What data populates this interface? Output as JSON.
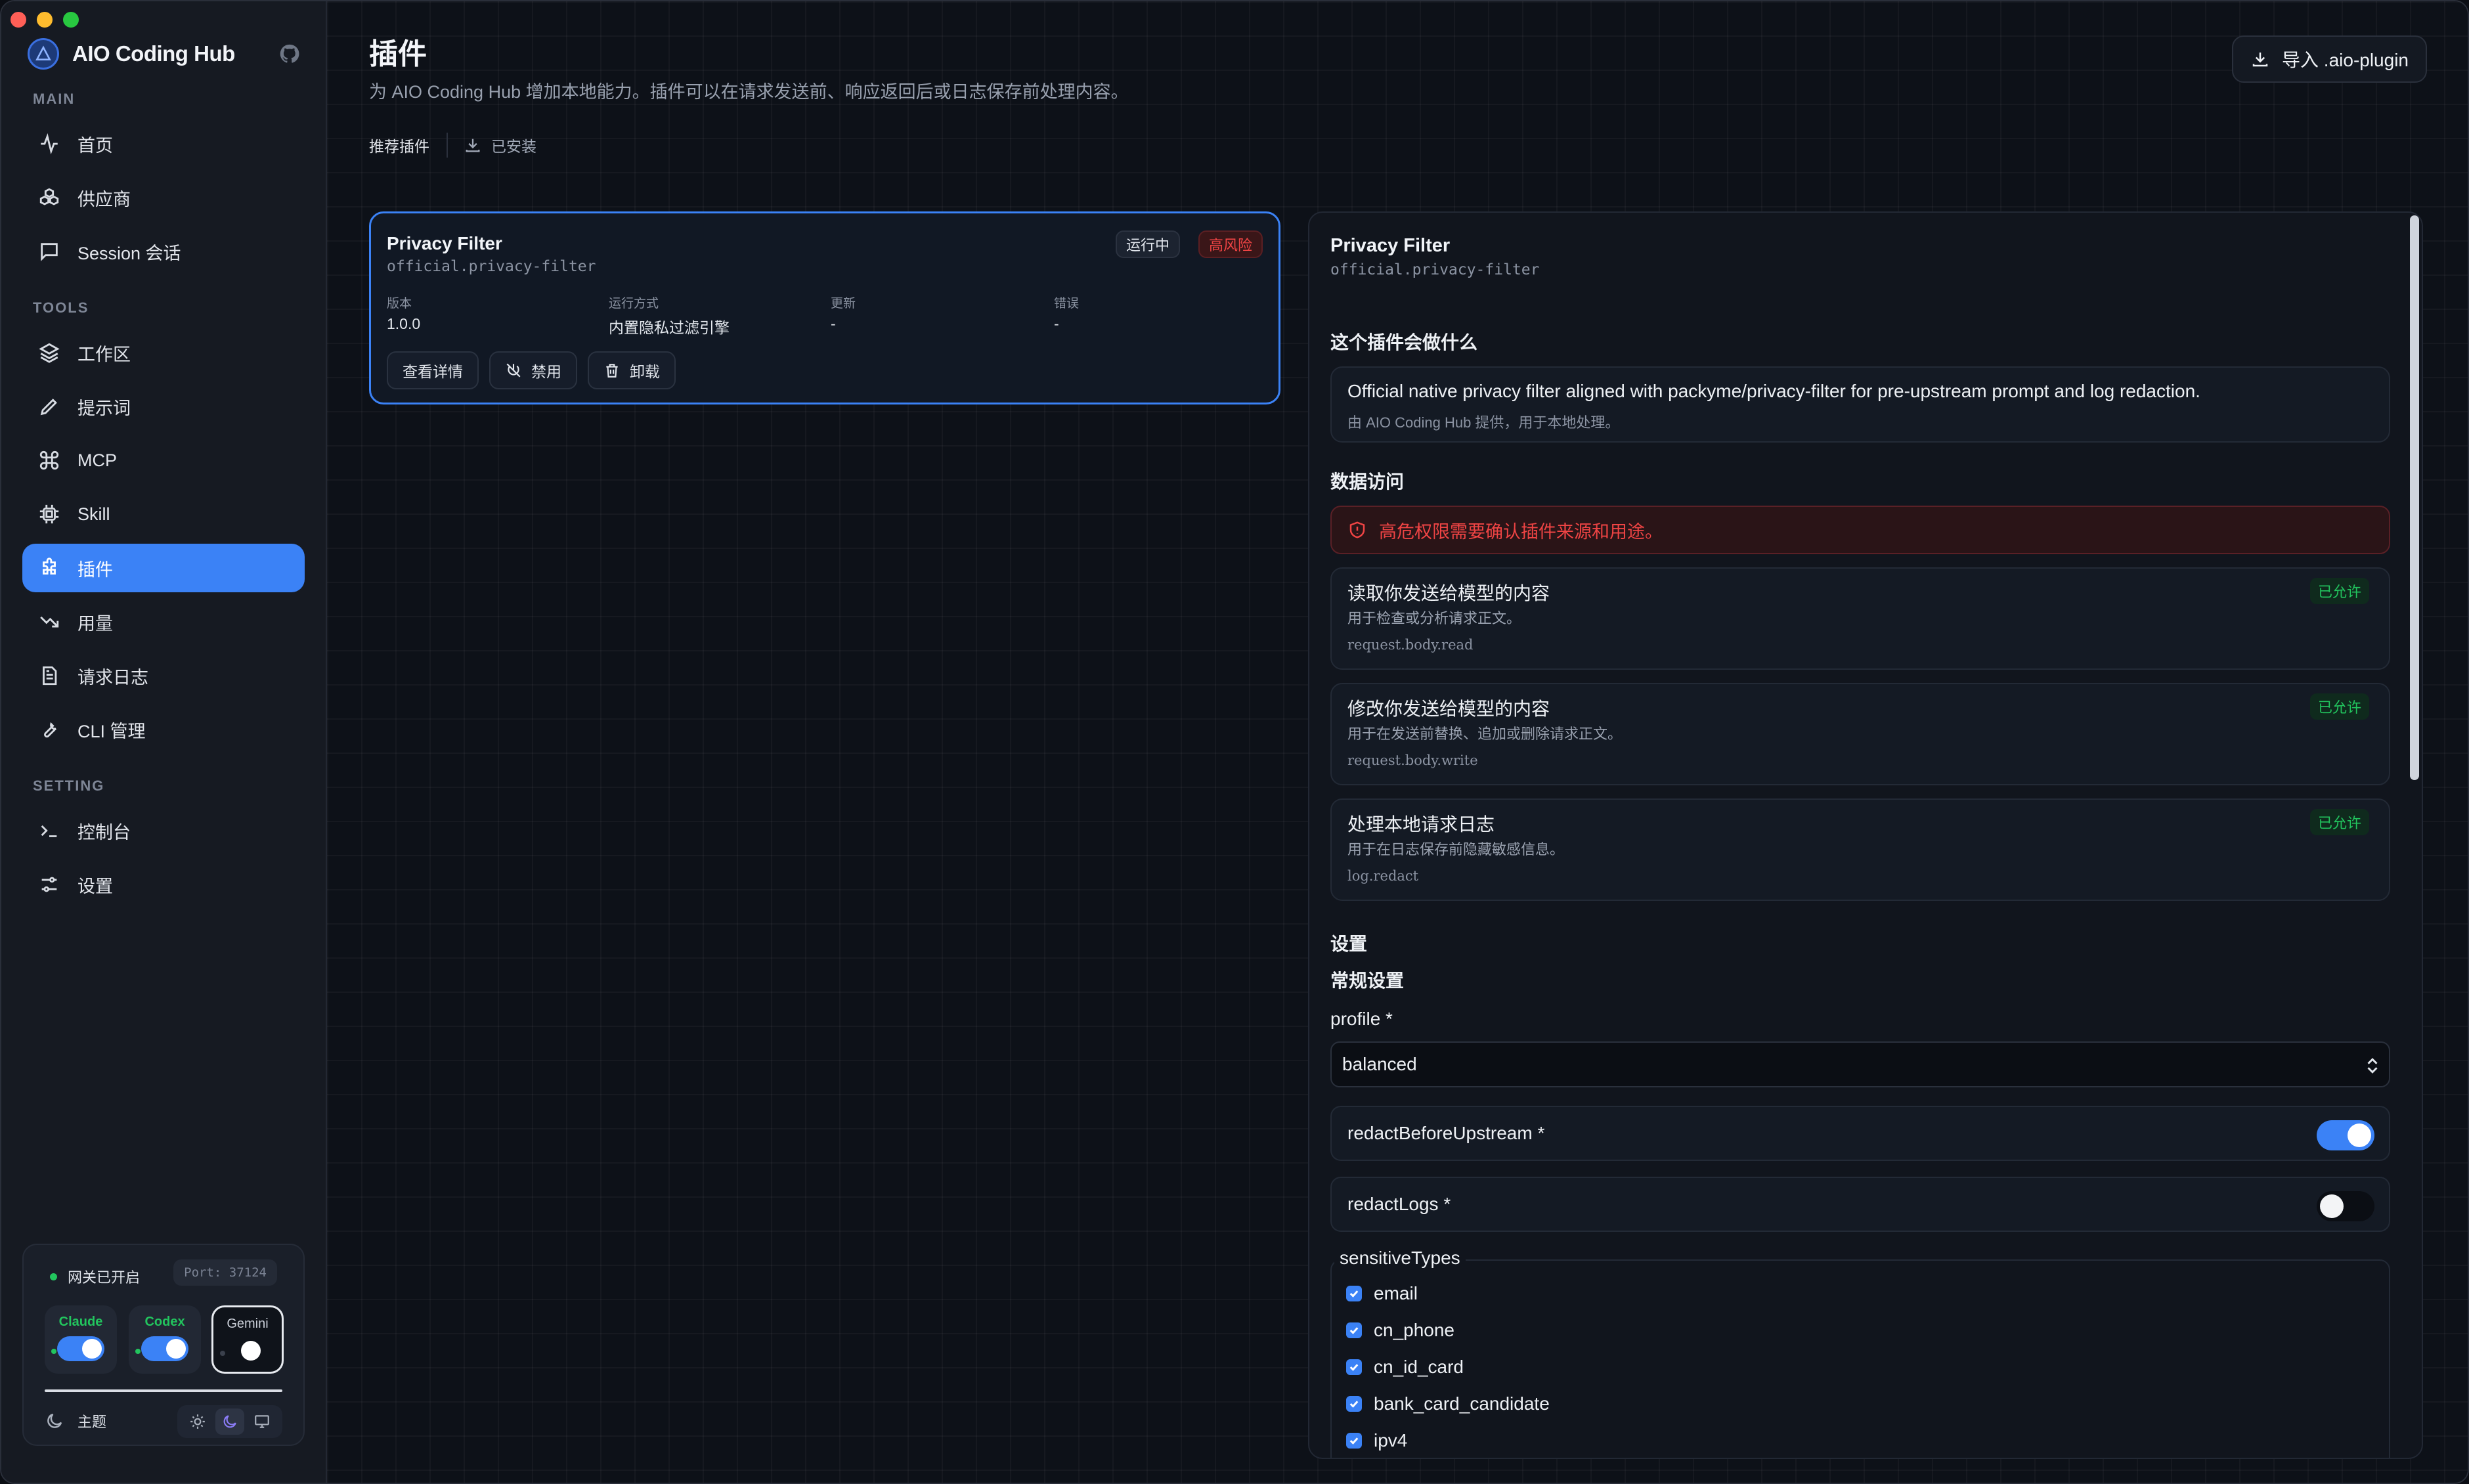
{
  "app": {
    "name": "AIO Coding Hub"
  },
  "sidebar": {
    "sections": {
      "main": "MAIN",
      "tools": "TOOLS",
      "setting": "SETTING"
    },
    "main_items": [
      {
        "label": "首页"
      },
      {
        "label": "供应商"
      },
      {
        "label": "Session 会话"
      }
    ],
    "tools_items": [
      {
        "label": "工作区"
      },
      {
        "label": "提示词"
      },
      {
        "label": "MCP"
      },
      {
        "label": "Skill"
      },
      {
        "label": "插件"
      },
      {
        "label": "用量"
      },
      {
        "label": "请求日志"
      },
      {
        "label": "CLI 管理"
      }
    ],
    "setting_items": [
      {
        "label": "控制台"
      },
      {
        "label": "设置"
      }
    ],
    "gateway": {
      "status": "网关已开启",
      "port": "Port: 37124",
      "clis": [
        {
          "name": "Claude",
          "enabled": true
        },
        {
          "name": "Codex",
          "enabled": true
        },
        {
          "name": "Gemini",
          "enabled": false
        }
      ],
      "theme_label": "主题"
    }
  },
  "header": {
    "title": "插件",
    "subtitle": "为 AIO Coding Hub 增加本地能力。插件可以在请求发送前、响应返回后或日志保存前处理内容。",
    "import_label": "导入 .aio-plugin",
    "tabs": [
      {
        "label": "推荐插件"
      },
      {
        "label": "已安装"
      }
    ]
  },
  "plugin_card": {
    "name": "Privacy Filter",
    "id": "official.privacy-filter",
    "status_badge": "运行中",
    "risk_badge": "高风险",
    "meta": [
      {
        "key": "版本",
        "value": "1.0.0"
      },
      {
        "key": "运行方式",
        "value": "内置隐私过滤引擎"
      },
      {
        "key": "更新",
        "value": "-"
      },
      {
        "key": "错误",
        "value": "-"
      }
    ],
    "actions": {
      "details": "查看详情",
      "disable": "禁用",
      "uninstall": "卸载"
    }
  },
  "detail": {
    "name": "Privacy Filter",
    "id": "official.privacy-filter",
    "what_heading": "这个插件会做什么",
    "description": "Official native privacy filter aligned with packyme/privacy-filter for pre-upstream prompt and log redaction.",
    "provider_note": "由 AIO Coding Hub 提供，用于本地处理。",
    "access_heading": "数据访问",
    "warning": "高危权限需要确认插件来源和用途。",
    "permissions": [
      {
        "title": "读取你发送给模型的内容",
        "desc": "用于检查或分析请求正文。",
        "code": "request.body.read",
        "status": "已允许"
      },
      {
        "title": "修改你发送给模型的内容",
        "desc": "用于在发送前替换、追加或删除请求正文。",
        "code": "request.body.write",
        "status": "已允许"
      },
      {
        "title": "处理本地请求日志",
        "desc": "用于在日志保存前隐藏敏感信息。",
        "code": "log.redact",
        "status": "已允许"
      }
    ],
    "settings_heading": "设置",
    "general_heading": "常规设置",
    "profile_label": "profile *",
    "profile_value": "balanced",
    "redact_upstream_label": "redactBeforeUpstream *",
    "redact_upstream": true,
    "redact_logs_label": "redactLogs *",
    "redact_logs": false,
    "sensitive_label": "sensitiveTypes",
    "sensitive_types": [
      {
        "label": "email",
        "checked": true
      },
      {
        "label": "cn_phone",
        "checked": true
      },
      {
        "label": "cn_id_card",
        "checked": true
      },
      {
        "label": "bank_card_candidate",
        "checked": true
      },
      {
        "label": "ipv4",
        "checked": true
      }
    ]
  },
  "colors": {
    "accent": "#3b82f6",
    "success": "#22c55e",
    "danger": "#ef4444"
  }
}
